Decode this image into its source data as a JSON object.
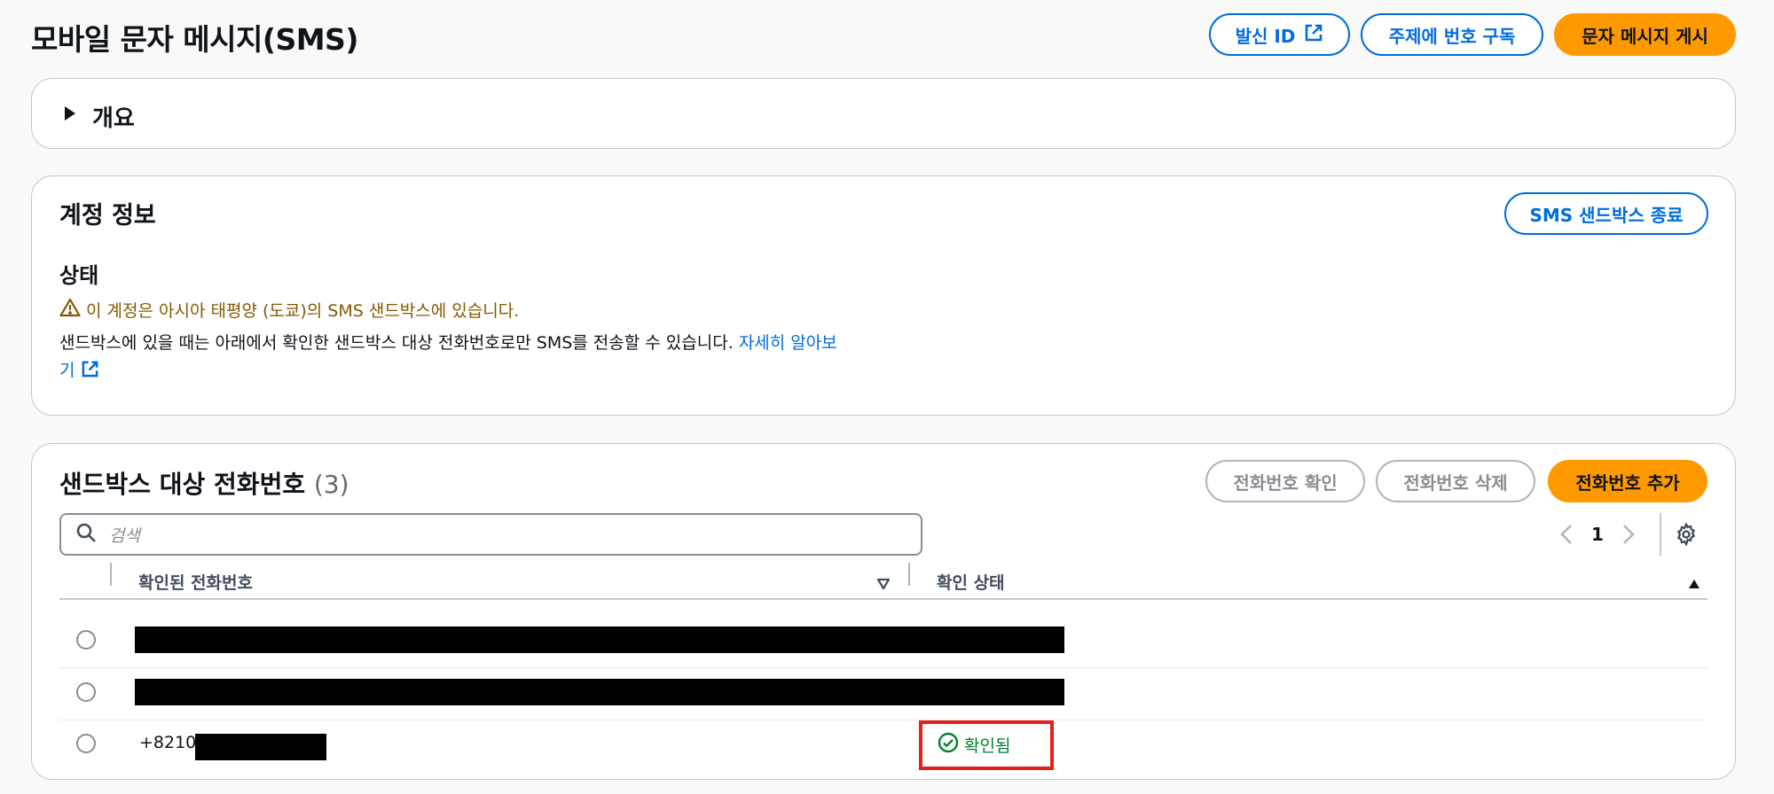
{
  "page": {
    "title": "모바일 문자 메시지(SMS)"
  },
  "header_actions": {
    "origination_id_label": "발신 ID",
    "subscribe_label": "주제에 번호 구독",
    "publish_label": "문자 메시지 게시"
  },
  "overview": {
    "label": "개요"
  },
  "account": {
    "title": "계정 정보",
    "exit_sandbox_label": "SMS 샌드박스 종료",
    "status_heading": "상태",
    "warning_text": "이 계정은 아시아 태평양 (도쿄)의 SMS 샌드박스에 있습니다.",
    "description": "샌드박스에 있을 때는 아래에서 확인한 샌드박스 대상 전화번호로만 SMS를 전송할 수 있습니다.",
    "learn_more_part1": "자세히 알아보",
    "learn_more_part2": "기"
  },
  "sandbox": {
    "title": "샌드박스 대상 전화번호",
    "count": "(3)",
    "verify_label": "전화번호 확인",
    "delete_label": "전화번호 삭제",
    "add_label": "전화번호 추가",
    "search_placeholder": "검색",
    "page_number": "1",
    "columns": {
      "phone": "확인된 전화번호",
      "status": "확인 상태"
    },
    "rows": [
      {
        "phone": "",
        "status": ""
      },
      {
        "phone": "",
        "status": ""
      },
      {
        "phone": "+8210",
        "status": "확인됨"
      }
    ]
  },
  "colors": {
    "accent": "#006ce0",
    "primary": "#ff9900",
    "warning": "#855900",
    "success": "#00802f",
    "highlight": "#e3201a"
  }
}
